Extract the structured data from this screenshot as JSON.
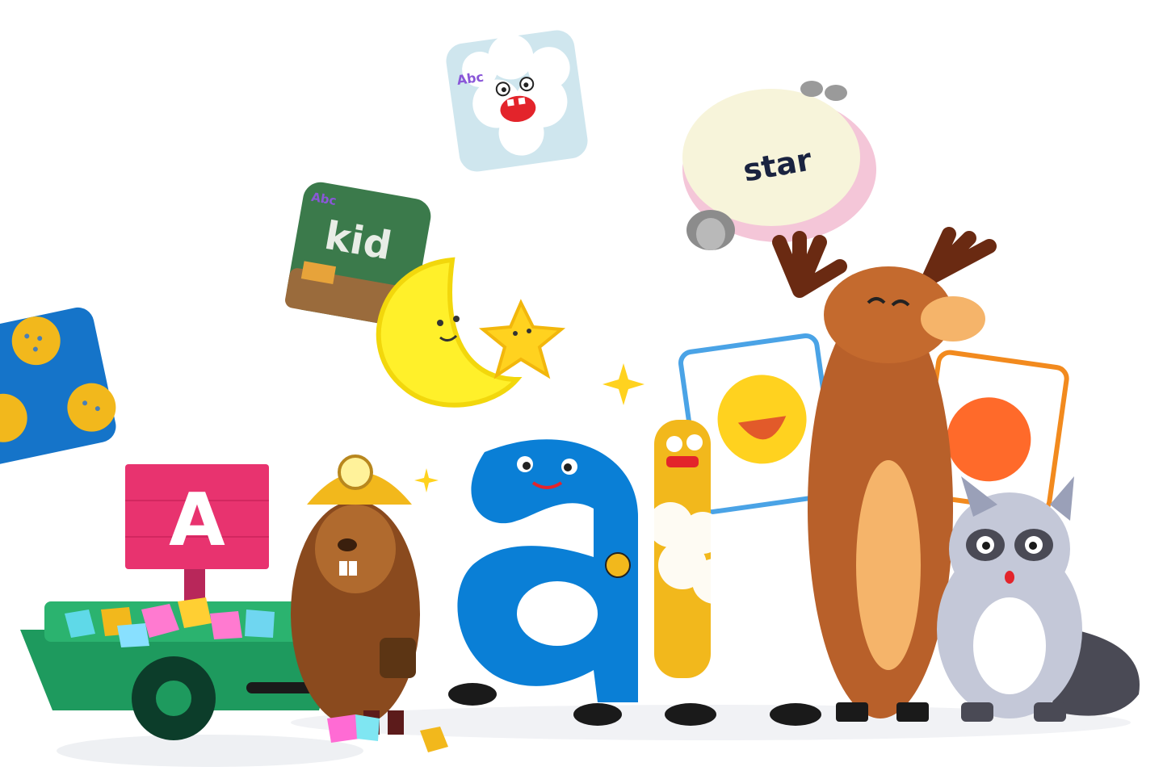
{
  "scene": {
    "app_tiles": [
      {
        "id": "bubble-monster",
        "badge": "Abc"
      },
      {
        "id": "chalkboard",
        "badge": "Abc",
        "word": "kid"
      },
      {
        "id": "crackers"
      }
    ],
    "sheep_word": "star",
    "sign_letter": "A",
    "letter_character": "a"
  },
  "colors": {
    "blue_letter": "#0a7fd6",
    "sign_pink": "#e8336f",
    "cart_green": "#1e9a5e",
    "moose_brown": "#b8602a",
    "yellow_moon": "#fff02a",
    "raccoon_grey": "#c4c8d8",
    "tile_blue": "#1574c9",
    "chalk_green": "#3b7a4b"
  }
}
